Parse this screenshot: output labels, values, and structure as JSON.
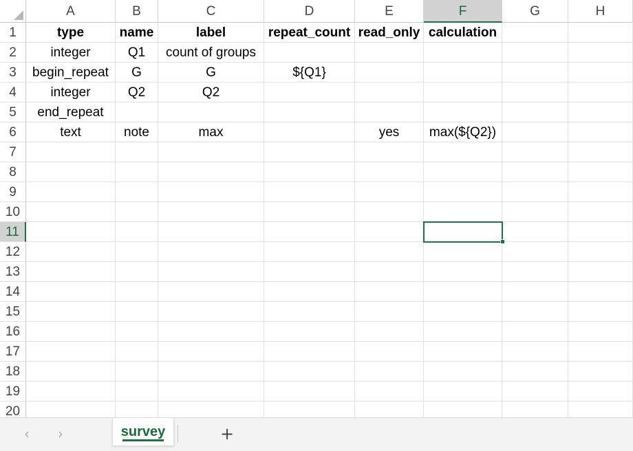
{
  "grid": {
    "columns": [
      "A",
      "B",
      "C",
      "D",
      "E",
      "F",
      "G",
      "H"
    ],
    "active_column": "F",
    "rows": [
      "1",
      "2",
      "3",
      "4",
      "5",
      "6",
      "7",
      "8",
      "9",
      "10",
      "11",
      "12",
      "13",
      "14",
      "15",
      "16",
      "17",
      "18",
      "19",
      "20"
    ],
    "active_row": "11",
    "selected_cell": "F11",
    "cells": [
      [
        "type",
        "name",
        "label",
        "repeat_count",
        "read_only",
        "calculation",
        "",
        ""
      ],
      [
        "integer",
        "Q1",
        "count of groups",
        "",
        "",
        "",
        "",
        ""
      ],
      [
        "begin_repeat",
        "G",
        "G",
        "${Q1}",
        "",
        "",
        "",
        ""
      ],
      [
        "integer",
        "Q2",
        "Q2",
        "",
        "",
        "",
        "",
        ""
      ],
      [
        "end_repeat",
        "",
        "",
        "",
        "",
        "",
        "",
        ""
      ],
      [
        "text",
        "note",
        "max",
        "",
        "yes",
        "max(${Q2})",
        "",
        ""
      ]
    ]
  },
  "tabs": {
    "sheet_name": "survey",
    "add_sheet": "+",
    "prev_icon": "chevron-left-icon",
    "next_icon": "chevron-right-icon"
  },
  "colors": {
    "accent": "#1e7145",
    "header_active_bg": "#d2d2d2",
    "gridline": "#e1e1e1"
  }
}
